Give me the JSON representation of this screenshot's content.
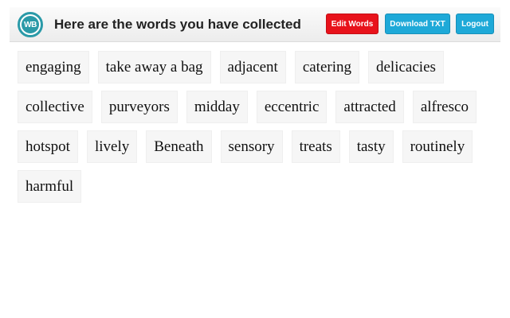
{
  "header": {
    "logo_text": "WB",
    "title": "Here are the words you have collected",
    "buttons": {
      "edit": "Edit Words",
      "download": "Download TXT",
      "logout": "Logout"
    }
  },
  "colors": {
    "brand": "#2a9aa8",
    "edit_button": "#e8121b",
    "primary_button": "#1ea9d8"
  },
  "words": [
    "engaging",
    "take away a bag",
    "adjacent",
    "catering",
    "delicacies",
    "collective",
    "purveyors",
    "midday",
    "eccentric",
    "attracted",
    "alfresco",
    "hotspot",
    "lively",
    "Beneath",
    "sensory",
    "treats",
    "tasty",
    "routinely",
    "harmful"
  ]
}
